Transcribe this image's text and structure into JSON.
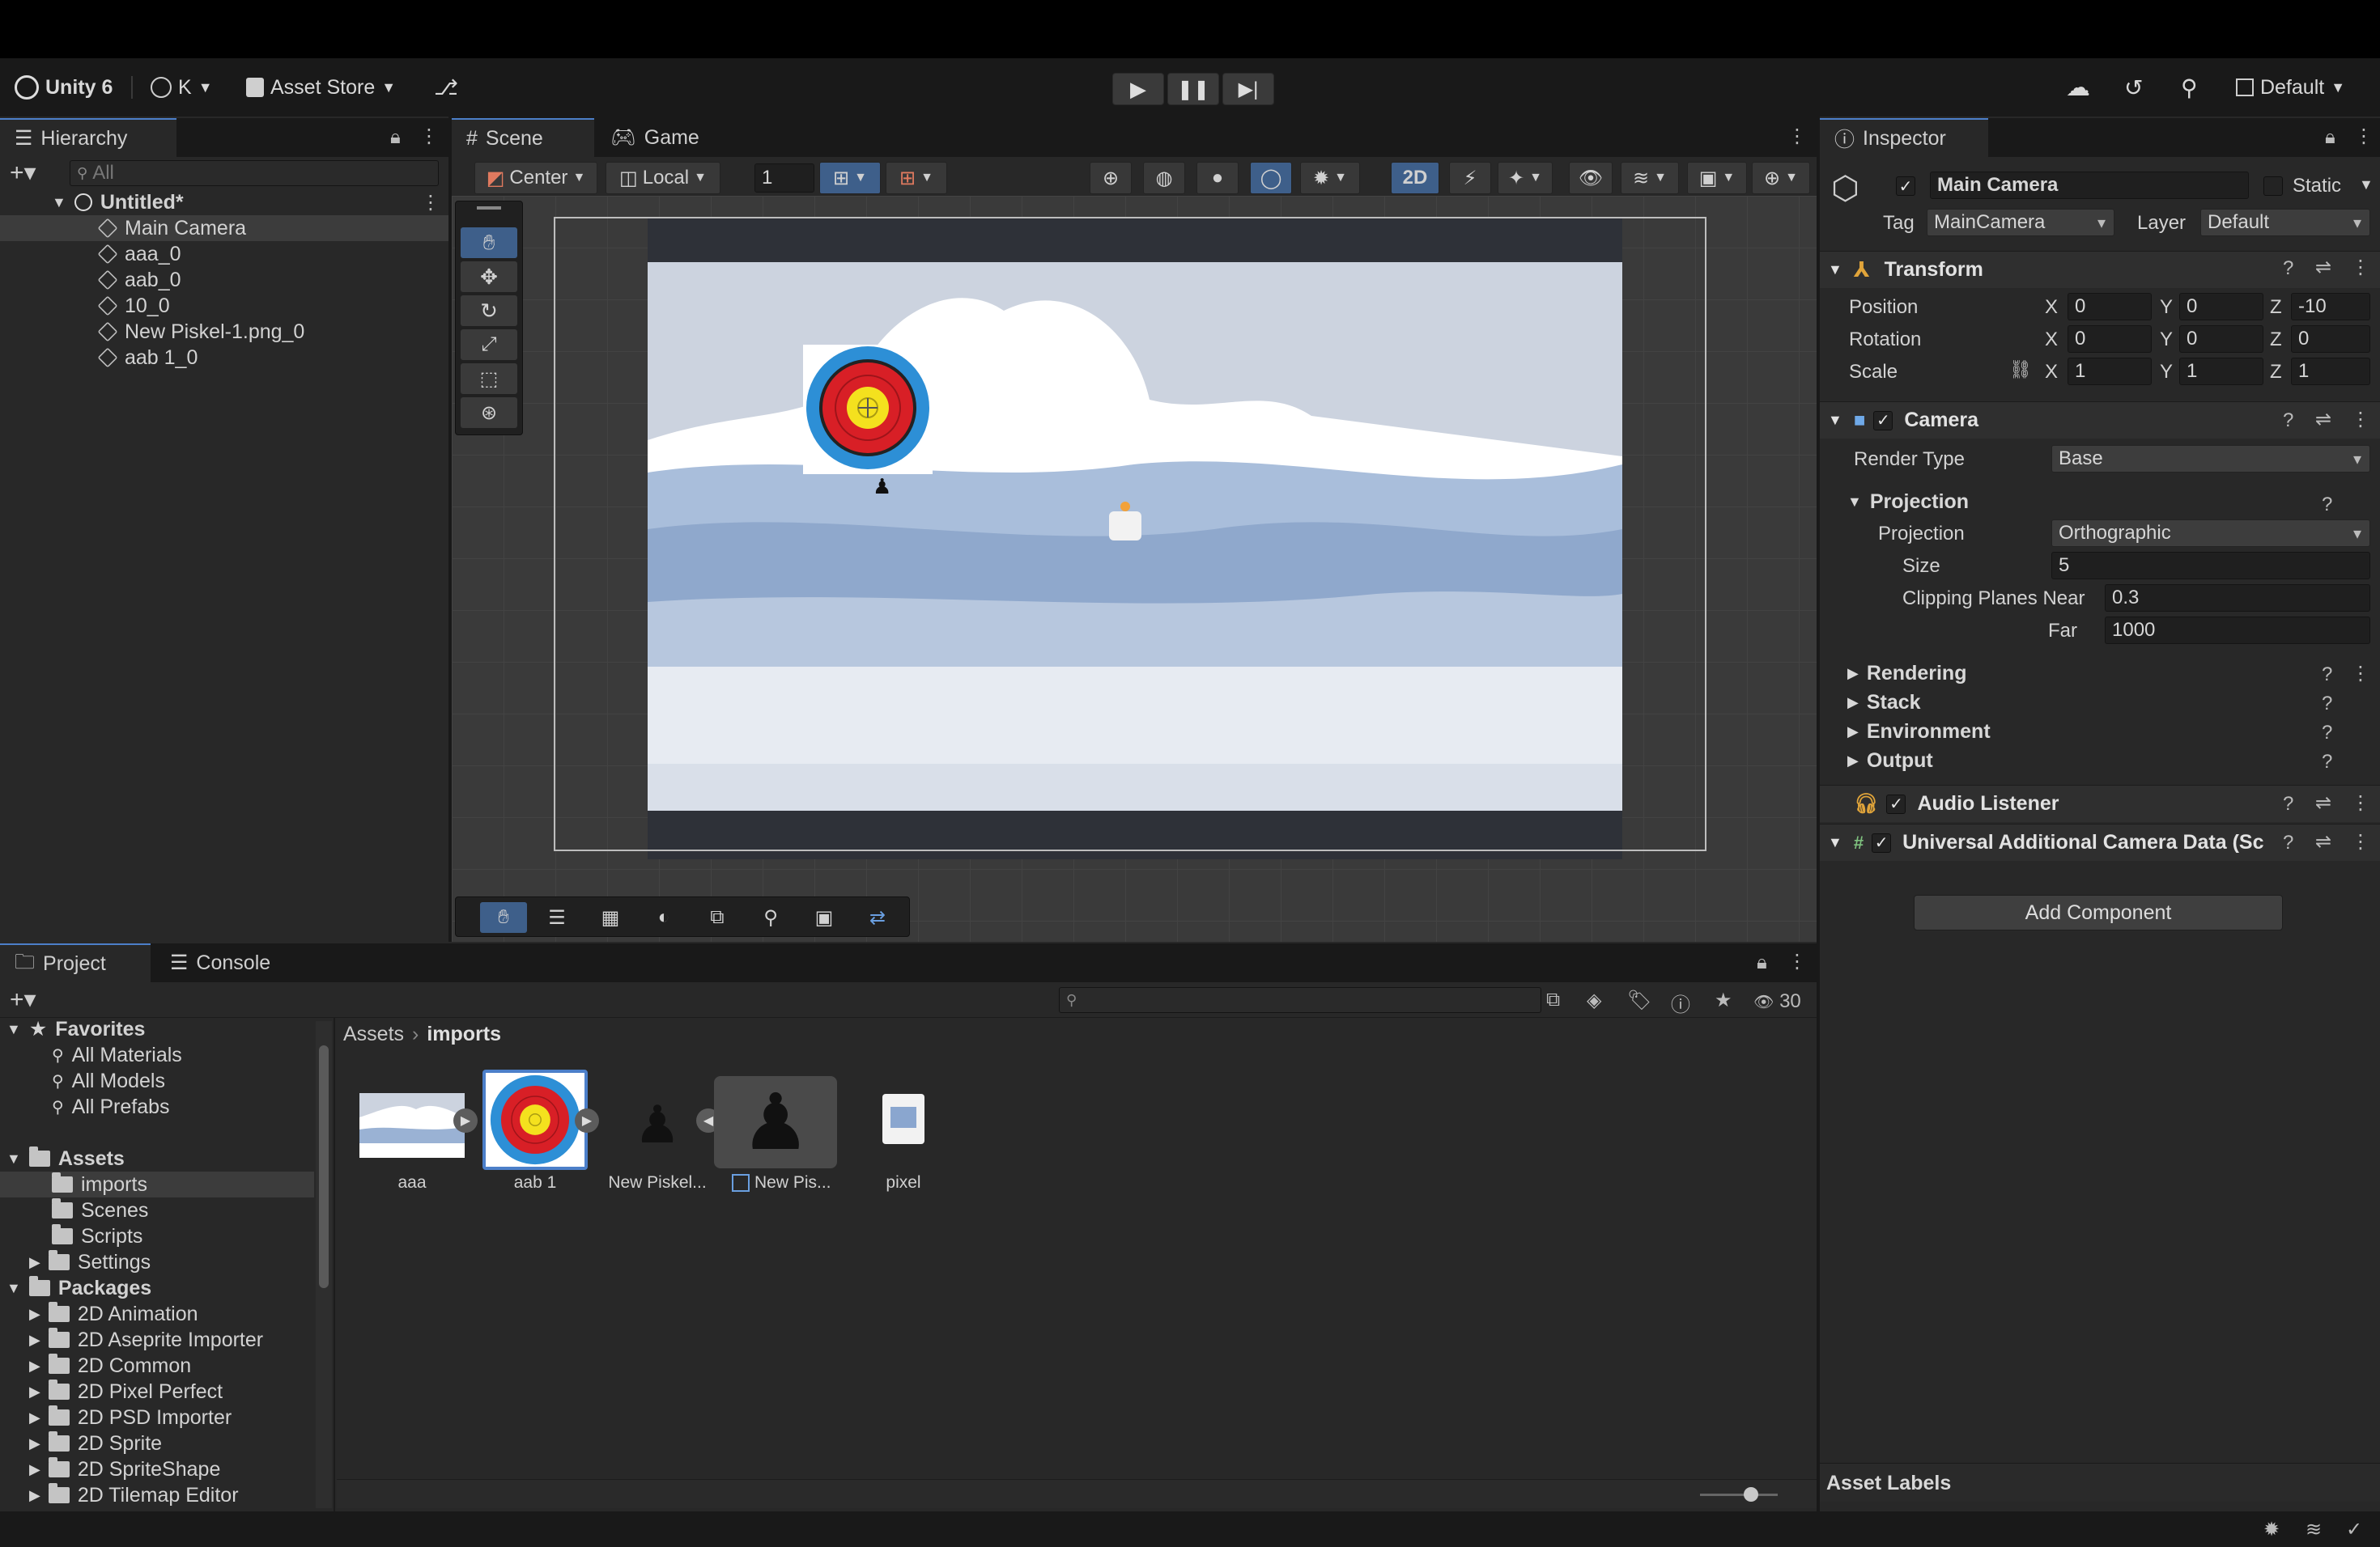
{
  "toolbar": {
    "unity_label": "Unity 6",
    "account_label": "K",
    "asset_store_label": "Asset Store",
    "layout_label": "Default"
  },
  "hierarchy": {
    "tab_label": "Hierarchy",
    "search_placeholder": "All",
    "scene_name": "Untitled*",
    "items": [
      {
        "label": "Main Camera"
      },
      {
        "label": "aaa_0"
      },
      {
        "label": "aab_0"
      },
      {
        "label": "10_0"
      },
      {
        "label": "New Piskel-1.png_0"
      },
      {
        "label": "aab 1_0"
      }
    ]
  },
  "scene_view": {
    "tabs": [
      {
        "label": "Scene"
      },
      {
        "label": "Game"
      }
    ],
    "pivot_label": "Center",
    "space_label": "Local",
    "grid_value": "1",
    "mode_2d_label": "2D"
  },
  "inspector": {
    "tab_label": "Inspector",
    "object_name": "Main Camera",
    "static_label": "Static",
    "tag_label": "Tag",
    "tag_value": "MainCamera",
    "layer_label": "Layer",
    "layer_value": "Default",
    "transform": {
      "title": "Transform",
      "position_label": "Position",
      "rotation_label": "Rotation",
      "scale_label": "Scale",
      "position": {
        "x": "0",
        "y": "0",
        "z": "-10"
      },
      "rotation": {
        "x": "0",
        "y": "0",
        "z": "0"
      },
      "scale": {
        "x": "1",
        "y": "1",
        "z": "1"
      },
      "axis_x": "X",
      "axis_y": "Y",
      "axis_z": "Z"
    },
    "camera": {
      "title": "Camera",
      "render_type_label": "Render Type",
      "render_type_value": "Base",
      "projection_section": "Projection",
      "projection_label": "Projection",
      "projection_value": "Orthographic",
      "size_label": "Size",
      "size_value": "5",
      "clipping_label": "Clipping Planes Near",
      "near_value": "0.3",
      "far_label": "Far",
      "far_value": "1000",
      "sections": [
        {
          "label": "Rendering"
        },
        {
          "label": "Stack"
        },
        {
          "label": "Environment"
        },
        {
          "label": "Output"
        }
      ]
    },
    "audio_listener": "Audio Listener",
    "urp_data": "Universal Additional Camera Data (Sc",
    "add_component": "Add Component",
    "asset_labels": "Asset Labels"
  },
  "project": {
    "tabs": [
      {
        "label": "Project"
      },
      {
        "label": "Console"
      }
    ],
    "hidden_count": "30",
    "favorites_label": "Favorites",
    "favorites": [
      {
        "label": "All Materials"
      },
      {
        "label": "All Models"
      },
      {
        "label": "All Prefabs"
      }
    ],
    "assets_label": "Assets",
    "asset_folders": [
      {
        "label": "imports"
      },
      {
        "label": "Scenes"
      },
      {
        "label": "Scripts"
      },
      {
        "label": "Settings"
      }
    ],
    "packages_label": "Packages",
    "packages": [
      {
        "label": "2D Animation"
      },
      {
        "label": "2D Aseprite Importer"
      },
      {
        "label": "2D Common"
      },
      {
        "label": "2D Pixel Perfect"
      },
      {
        "label": "2D PSD Importer"
      },
      {
        "label": "2D Sprite"
      },
      {
        "label": "2D SpriteShape"
      },
      {
        "label": "2D Tilemap Editor"
      }
    ],
    "breadcrumb": {
      "root": "Assets",
      "current": "imports"
    },
    "assets": [
      {
        "label": "aaa"
      },
      {
        "label": "aab 1"
      },
      {
        "label": "New Piskel..."
      },
      {
        "label": "New Pis..."
      },
      {
        "label": "pixel"
      }
    ]
  },
  "colors": {
    "accent": "#4c7fc9",
    "panel": "#282828",
    "scene_bg": "#3a3a3a"
  }
}
